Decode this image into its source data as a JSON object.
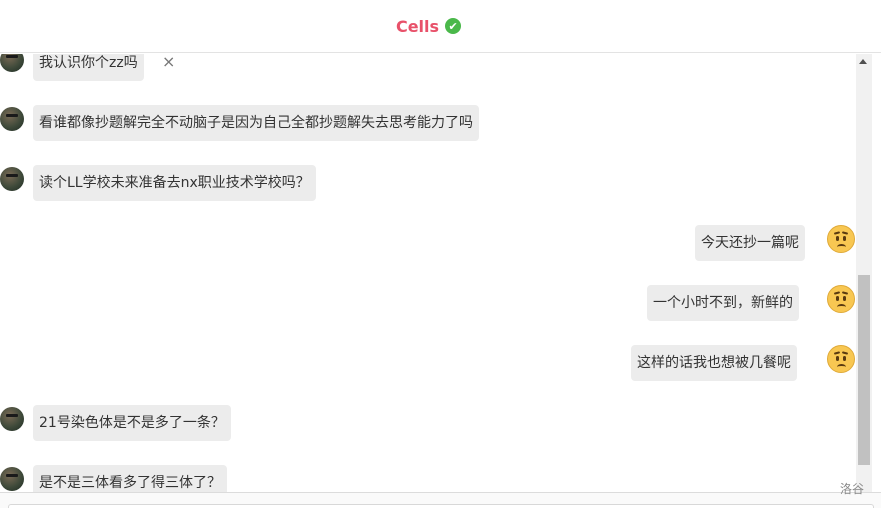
{
  "header": {
    "title": "Cells",
    "verified_icon": "check-circle-icon"
  },
  "messages": [
    {
      "side": "left",
      "text": "我认识你个zz吗",
      "has_close": true
    },
    {
      "side": "left",
      "text": "看谁都像抄题解完全不动脑子是因为自己全都抄题解失去思考能力了吗"
    },
    {
      "side": "left",
      "text": "读个LL学校未来准备去nx职业技术学校吗？"
    },
    {
      "side": "right",
      "text": "今天还抄一篇呢"
    },
    {
      "side": "right",
      "text": "一个小时不到，新鲜的"
    },
    {
      "side": "right",
      "text": "这样的话我也想被几餐呢"
    },
    {
      "side": "left",
      "text": "21号染色体是不是多了一条？"
    },
    {
      "side": "left",
      "text": "是不是三体看多了得三体了？"
    }
  ],
  "close_glyph": "×",
  "corner_text": "洛谷",
  "colors": {
    "accent": "#e8516a",
    "verified": "#4ab84a",
    "bubble": "#ececec"
  }
}
